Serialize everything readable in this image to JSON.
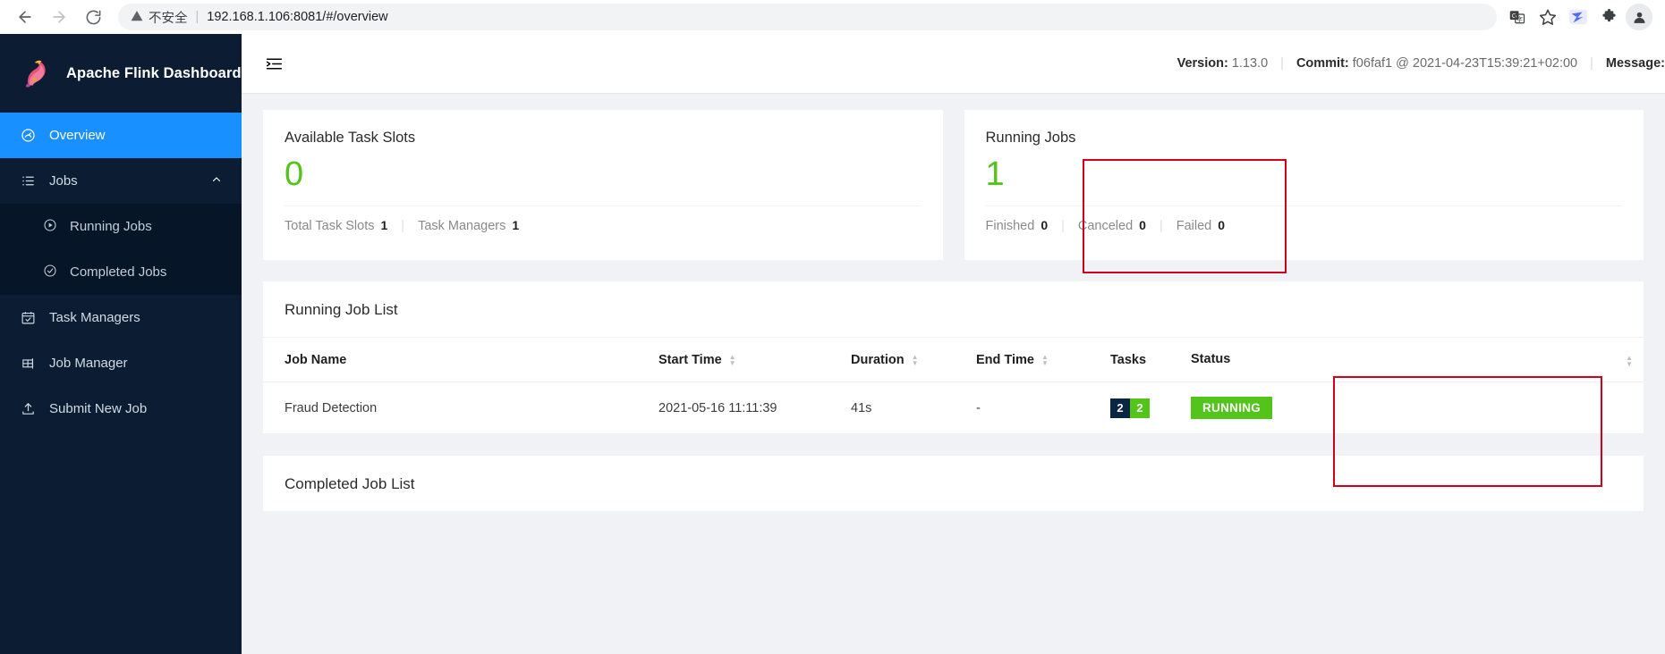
{
  "browser": {
    "back_icon": "back-arrow-icon",
    "forward_icon": "forward-arrow-icon",
    "reload_icon": "reload-icon",
    "security_icon": "warning-triangle-icon",
    "security_label": "不安全",
    "url": "192.168.1.106:8081/#/overview",
    "url_host": "192.168.1.106:8081",
    "url_path": "/#/overview",
    "toolbar_icons": [
      "translate-icon",
      "bookmark-star-icon",
      "extension-blue-icon",
      "extensions-puzzle-icon",
      "profile-avatar-icon"
    ]
  },
  "sidebar": {
    "brand": "Apache Flink Dashboard",
    "logo_icon": "flink-squirrel-logo",
    "items": [
      {
        "label": "Overview",
        "icon": "dashboard-icon",
        "active": true
      },
      {
        "label": "Jobs",
        "icon": "list-icon",
        "active": false,
        "expanded": true,
        "chevron": "chevron-up-icon"
      },
      {
        "label": "Running Jobs",
        "icon": "play-circle-icon",
        "sub": true
      },
      {
        "label": "Completed Jobs",
        "icon": "check-circle-icon",
        "sub": true
      },
      {
        "label": "Task Managers",
        "icon": "calendar-check-icon",
        "active": false
      },
      {
        "label": "Job Manager",
        "icon": "grid-icon",
        "active": false
      },
      {
        "label": "Submit New Job",
        "icon": "upload-icon",
        "active": false
      }
    ]
  },
  "topbar": {
    "collapse_icon": "menu-fold-icon",
    "version_label": "Version:",
    "version_value": "1.13.0",
    "commit_label": "Commit:",
    "commit_value": "f06faf1 @ 2021-04-23T15:39:21+02:00",
    "message_label": "Message:"
  },
  "cards": {
    "task_slots": {
      "title": "Available Task Slots",
      "value": "0",
      "value_color": "#52c41a",
      "stats": [
        {
          "label": "Total Task Slots",
          "value": "1"
        },
        {
          "label": "Task Managers",
          "value": "1"
        }
      ]
    },
    "running_jobs": {
      "title": "Running Jobs",
      "value": "1",
      "value_color": "#52c41a",
      "stats": [
        {
          "label": "Finished",
          "value": "0"
        },
        {
          "label": "Canceled",
          "value": "0"
        },
        {
          "label": "Failed",
          "value": "0"
        }
      ]
    }
  },
  "running_job_list": {
    "title": "Running Job List",
    "columns": [
      "Job Name",
      "Start Time",
      "Duration",
      "End Time",
      "Tasks",
      "Status"
    ],
    "rows": [
      {
        "job_name": "Fraud Detection",
        "start_time": "2021-05-16 11:11:39",
        "duration": "41s",
        "end_time": "-",
        "tasks_total": "2",
        "tasks_running": "2",
        "status": "RUNNING"
      }
    ]
  },
  "completed_job_list": {
    "title": "Completed Job List"
  },
  "annotations": {
    "running_jobs_box": "red-highlight-box",
    "tasks_status_box": "red-highlight-box",
    "color": "#d0021b"
  }
}
